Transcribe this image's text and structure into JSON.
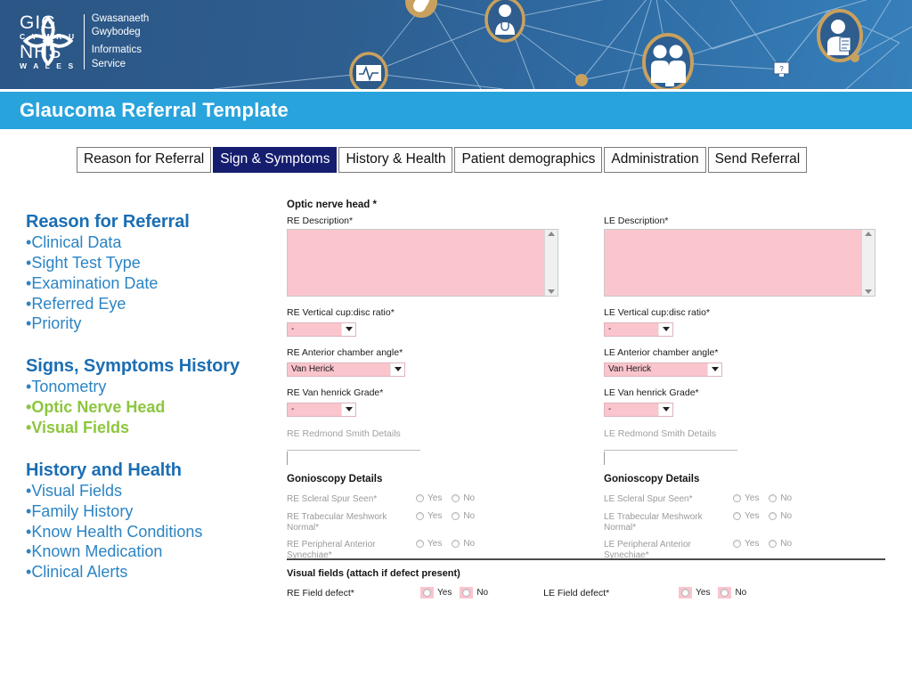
{
  "header": {
    "logo": {
      "gig": "GIG",
      "cymru": "C Y M R U",
      "nhs": "NHS",
      "wales": "W A L E S",
      "service_line1": "Gwasanaeth",
      "service_line2": "Gwybodeg",
      "service_line3": "Informatics",
      "service_line4": "Service"
    },
    "banner_icons": [
      "pill-icon",
      "doctor-icon",
      "heartbeat-icon",
      "family-icon",
      "monitor-icon",
      "clipboard-person-icon"
    ],
    "colors": {
      "banner_dark": "#2b5685",
      "banner_light": "#3680bb",
      "title_bar": "#29a3dc",
      "accent_gold": "#c9a15e"
    }
  },
  "title_bar": {
    "title": "Glaucoma Referral Template"
  },
  "tabs": [
    {
      "label": "Reason for Referral",
      "active": false
    },
    {
      "label": "Sign & Symptoms",
      "active": true
    },
    {
      "label": "History & Health",
      "active": false
    },
    {
      "label": "Patient demographics",
      "active": false
    },
    {
      "label": "Administration",
      "active": false
    },
    {
      "label": "Send Referral",
      "active": false
    }
  ],
  "outline": {
    "groups": [
      {
        "heading": "Reason for Referral",
        "items": [
          {
            "text": "Clinical Data",
            "highlight": false
          },
          {
            "text": "Sight Test Type",
            "highlight": false
          },
          {
            "text": "Examination Date",
            "highlight": false
          },
          {
            "text": "Referred Eye",
            "highlight": false
          },
          {
            "text": "Priority",
            "highlight": false
          }
        ]
      },
      {
        "heading": "Signs, Symptoms History",
        "items": [
          {
            "text": "Tonometry",
            "highlight": false
          },
          {
            "text": "Optic Nerve Head",
            "highlight": true
          },
          {
            "text": "Visual Fields",
            "highlight": true
          }
        ]
      },
      {
        "heading": "History and Health",
        "items": [
          {
            "text": "Visual Fields",
            "highlight": false
          },
          {
            "text": "Family History",
            "highlight": false
          },
          {
            "text": "Know Health Conditions",
            "highlight": false
          },
          {
            "text": "Known Medication",
            "highlight": false
          },
          {
            "text": "Clinical Alerts",
            "highlight": false
          }
        ]
      }
    ],
    "colors": {
      "blue": "#2b84c4",
      "heading_blue": "#1b6eb3",
      "green": "#8cc63e"
    }
  },
  "form": {
    "section_title": "Optic nerve head *",
    "required_field_color": "#fbc5ce",
    "re": {
      "description_label": "RE Description*",
      "description_value": "",
      "cup_disc_label": "RE Vertical cup:disc ratio*",
      "cup_disc_value": "-",
      "anterior_angle_label": "RE Anterior chamber angle*",
      "anterior_angle_value": "Van Herick",
      "van_henrick_label": "RE Van henrick Grade*",
      "van_henrick_value": "-",
      "redmond_label": "RE Redmond Smith Details",
      "redmond_value": "",
      "gonioscopy_title": "Gonioscopy Details",
      "gonioscopy_rows": [
        {
          "label": "RE Scleral Spur Seen*",
          "yes": "Yes",
          "no": "No"
        },
        {
          "label": "RE Trabecular Meshwork Normal*",
          "yes": "Yes",
          "no": "No"
        },
        {
          "label": "RE Peripheral Anterior Synechiae*",
          "yes": "Yes",
          "no": "No"
        }
      ]
    },
    "le": {
      "description_label": "LE Description*",
      "description_value": "",
      "cup_disc_label": "LE Vertical cup:disc ratio*",
      "cup_disc_value": "-",
      "anterior_angle_label": "LE Anterior chamber angle*",
      "anterior_angle_value": "Van Herick",
      "van_henrick_label": "LE Van henrick Grade*",
      "van_henrick_value": "-",
      "redmond_label": "LE Redmond Smith Details",
      "redmond_value": "",
      "gonioscopy_title": "Gonioscopy Details",
      "gonioscopy_rows": [
        {
          "label": "LE Scleral Spur Seen*",
          "yes": "Yes",
          "no": "No"
        },
        {
          "label": "LE Trabecular Meshwork Normal*",
          "yes": "Yes",
          "no": "No"
        },
        {
          "label": "LE Peripheral Anterior Synechiae*",
          "yes": "Yes",
          "no": "No"
        }
      ]
    },
    "visual_fields": {
      "title": "Visual fields (attach if defect present)",
      "re_label": "RE Field defect*",
      "re_yes": "Yes",
      "re_no": "No",
      "le_label": "LE Field defect*",
      "le_yes": "Yes",
      "le_no": "No"
    }
  }
}
